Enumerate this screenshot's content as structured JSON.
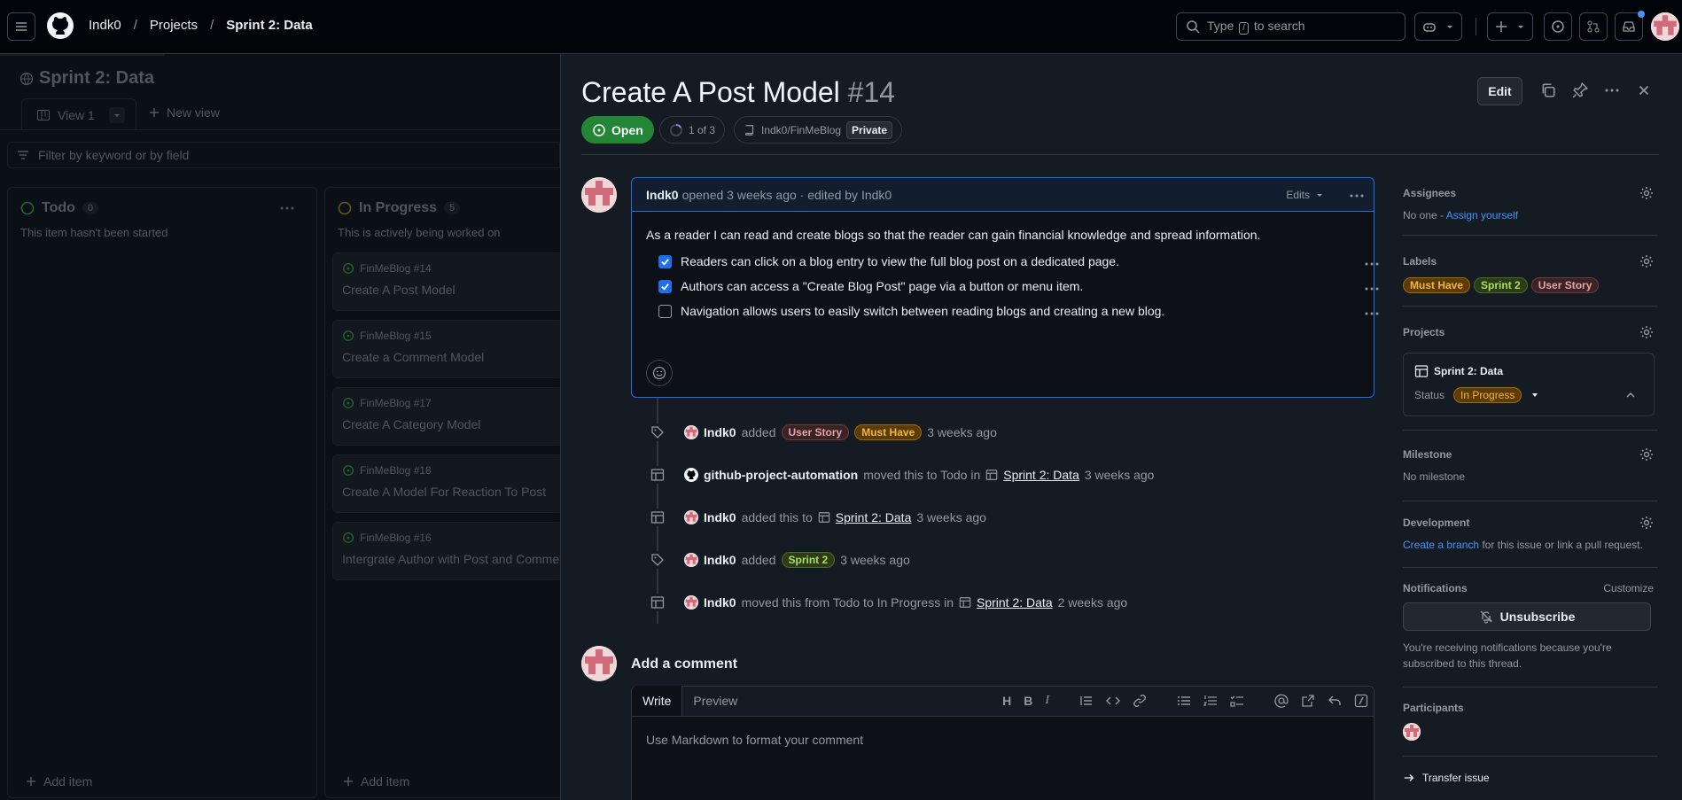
{
  "topbar": {
    "breadcrumbs": [
      "Indk0",
      "Projects",
      "Sprint 2: Data"
    ],
    "search_placeholder_pre": "Type",
    "search_key": "/",
    "search_placeholder_post": "to search"
  },
  "board": {
    "title": "Sprint 2: Data",
    "view_tab": "View 1",
    "new_view": "New view",
    "filter_placeholder": "Filter by keyword or by field",
    "columns": [
      {
        "name": "Todo",
        "count": "0",
        "desc": "This item hasn't been started",
        "add": "Add item"
      },
      {
        "name": "In Progress",
        "count": "5",
        "desc": "This is actively being worked on",
        "add": "Add item"
      }
    ],
    "cards": [
      {
        "repo": "FinMeBlog #14",
        "title": "Create A Post Model"
      },
      {
        "repo": "FinMeBlog #15",
        "title": "Create a Comment Model"
      },
      {
        "repo": "FinMeBlog #17",
        "title": "Create A Category Model"
      },
      {
        "repo": "FinMeBlog #18",
        "title": "Create A Model For Reaction To Post"
      },
      {
        "repo": "FinMeBlog #16",
        "title": "Intergrate Author with Post and Comme"
      }
    ]
  },
  "issue": {
    "title": "Create A Post Model",
    "number": "#14",
    "state": "Open",
    "subtasks": "1 of 3",
    "repo": "Indk0/FinMeBlog",
    "visibility": "Private",
    "edit": "Edit",
    "comment": {
      "author": "Indk0",
      "meta": "opened 3 weeks ago · edited by Indk0",
      "edits": "Edits",
      "body": "As a reader I can read and create blogs so that the reader can gain financial knowledge and spread information.",
      "tasks": [
        {
          "text": "Readers can click on a blog entry to view the full blog post on a dedicated page.",
          "checked": true
        },
        {
          "text": "Authors can access a \"Create Blog Post\" page via a button or menu item.",
          "checked": true
        },
        {
          "text": "Navigation allows users to easily switch between reading blogs and creating a new blog.",
          "checked": false
        }
      ]
    },
    "events": [
      {
        "actor": "Indk0",
        "pre": "added",
        "labels": [
          "User Story",
          "Must Have"
        ],
        "post": "",
        "link": "",
        "time": "3 weeks ago"
      },
      {
        "actor": "github-project-automation",
        "pre": "moved this to Todo in",
        "labels": [],
        "link": "Sprint 2: Data",
        "time": "3 weeks ago"
      },
      {
        "actor": "Indk0",
        "pre": "added this to",
        "labels": [],
        "link": "Sprint 2: Data",
        "time": "3 weeks ago"
      },
      {
        "actor": "Indk0",
        "pre": "added",
        "labels": [
          "Sprint 2"
        ],
        "link": "",
        "time": "3 weeks ago"
      },
      {
        "actor": "Indk0",
        "pre": "moved this from Todo to In Progress in",
        "labels": [],
        "link": "Sprint 2: Data",
        "time": "2 weeks ago"
      }
    ],
    "add_comment": "Add a comment",
    "editor": {
      "write": "Write",
      "preview": "Preview",
      "placeholder": "Use Markdown to format your comment"
    }
  },
  "sidebar": {
    "assignees": {
      "title": "Assignees",
      "value": "No one -",
      "link": "Assign yourself"
    },
    "labels": {
      "title": "Labels",
      "items": [
        "Must Have",
        "Sprint 2",
        "User Story"
      ]
    },
    "projects": {
      "title": "Projects",
      "project": "Sprint 2: Data",
      "status_label": "Status",
      "status": "In Progress"
    },
    "milestone": {
      "title": "Milestone",
      "value": "No milestone"
    },
    "development": {
      "title": "Development",
      "link": "Create a branch",
      "rest": "for this issue or link a pull request."
    },
    "notifications": {
      "title": "Notifications",
      "customize": "Customize",
      "button": "Unsubscribe",
      "note": "You're receiving notifications because you're subscribed to this thread."
    },
    "participants": {
      "title": "Participants"
    },
    "transfer": "Transfer issue"
  },
  "colors": {
    "open": "#238636",
    "accent": "#1f6feb",
    "link": "#4493f8"
  }
}
